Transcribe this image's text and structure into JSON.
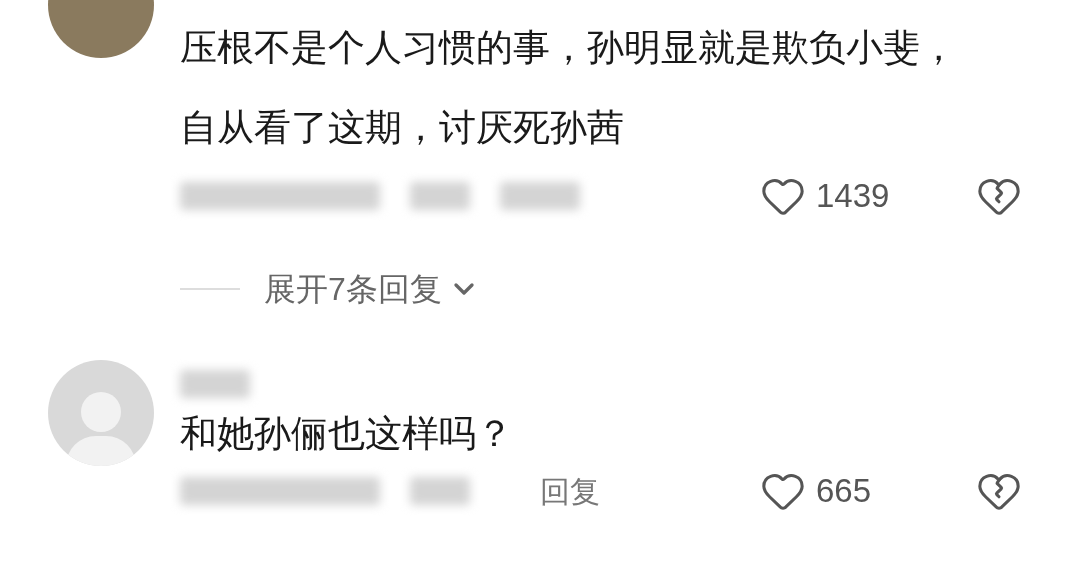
{
  "comments": [
    {
      "kind": "photo",
      "name_blurred": false,
      "text": "压根不是个人习惯的事，孙明显就是欺负小斐，自从看了这期，讨厌死孙茜",
      "likes": "1439",
      "expand_label": "展开7条回复"
    },
    {
      "kind": "silhouette",
      "name_blurred": true,
      "text": "和她孙俪也这样吗？",
      "reply_label": "回复",
      "likes": "665"
    }
  ]
}
